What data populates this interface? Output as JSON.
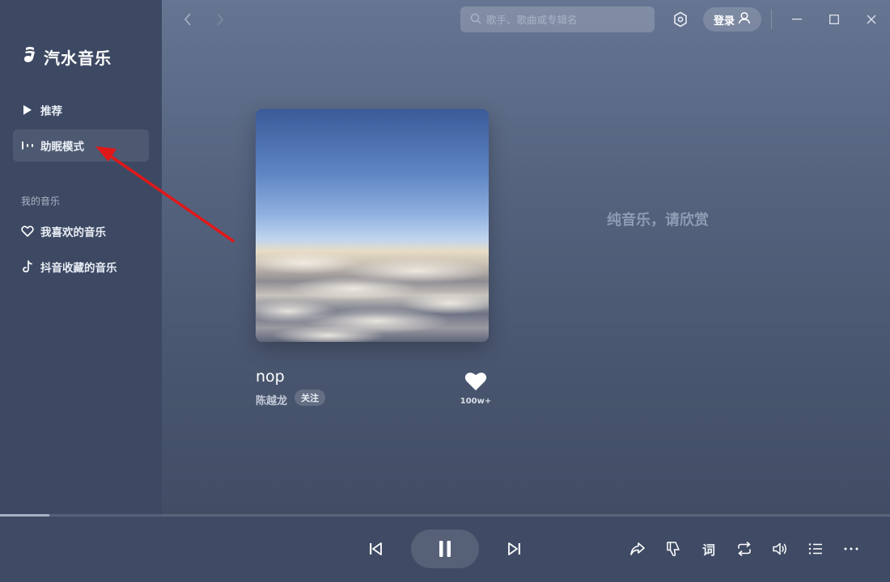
{
  "app": {
    "name": "汽水音乐"
  },
  "sidebar": {
    "items": [
      {
        "label": "推荐",
        "icon": "play-icon"
      },
      {
        "label": "助眠模式",
        "icon": "sleep-wave-icon"
      }
    ],
    "section_label": "我的音乐",
    "my_music": [
      {
        "label": "我喜欢的音乐",
        "icon": "heart-outline-icon"
      },
      {
        "label": "抖音收藏的音乐",
        "icon": "douyin-icon"
      }
    ]
  },
  "topbar": {
    "search_placeholder": "歌手、歌曲或专辑名",
    "login_label": "登录"
  },
  "now_playing": {
    "title": "nop",
    "artist": "陈越龙",
    "follow_label": "关注",
    "like_count": "100w+",
    "lyric_hint": "纯音乐，请欣赏",
    "progress": 0.055
  },
  "player": {
    "lyric_label": "词"
  },
  "colors": {
    "sidebar_bg": "#3d4963",
    "active_item_bg": "#4d5971",
    "player_bg": "#3f4b64",
    "annotation_arrow": "#e01818"
  }
}
